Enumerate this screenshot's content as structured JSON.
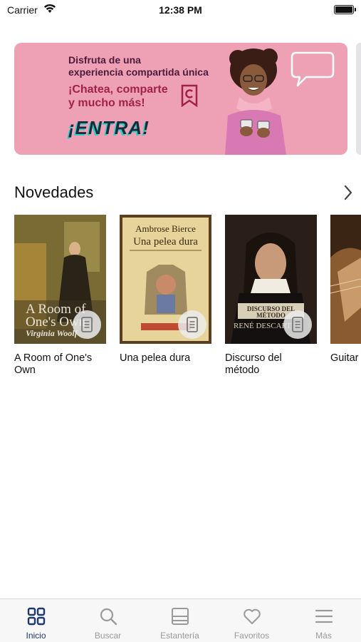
{
  "status_bar": {
    "carrier": "Carrier",
    "time": "12:38 PM"
  },
  "banner": {
    "line1": "Disfruta de una",
    "line2": "experiencia compartida única",
    "line3": "¡Chatea, comparte",
    "line4": "y mucho más!",
    "cta": "¡ENTRA!",
    "colors": {
      "background": "#eea1b5",
      "text": "#4d1a3c",
      "accent": "#a2214a",
      "cta_shadow": "#2bd0c8"
    }
  },
  "section": {
    "title": "Novedades"
  },
  "books": [
    {
      "title": "A Room of One's Own",
      "cover_title_1": "A Room of",
      "cover_title_2": "One's Own",
      "cover_author": "Virginia Woolf"
    },
    {
      "title": "Una pelea dura",
      "cover_author": "Ambrose Bierce",
      "cover_title": "Una pelea dura"
    },
    {
      "title": "Discurso del método",
      "cover_title_1": "DISCURSO DEL",
      "cover_title_2": "MÉTODO",
      "cover_author": "RENÉ DESCARTES"
    },
    {
      "title": "Guitar"
    }
  ],
  "tabs": [
    {
      "label": "Inicio",
      "icon": "grid-icon",
      "active": true
    },
    {
      "label": "Buscar",
      "icon": "search-icon"
    },
    {
      "label": "Estantería",
      "icon": "shelf-icon"
    },
    {
      "label": "Favoritos",
      "icon": "heart-icon"
    },
    {
      "label": "Más",
      "icon": "menu-icon"
    }
  ],
  "colors": {
    "tab_active": "#1c3a6e",
    "tab_inactive": "#9a9a9a"
  }
}
